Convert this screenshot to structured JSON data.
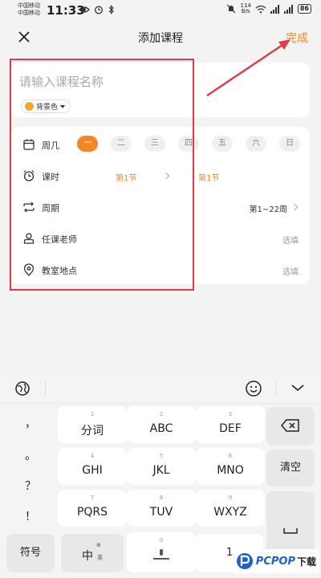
{
  "status_bar": {
    "carrier1": "中国移动",
    "carrier2": "中国移动",
    "time": "11:33",
    "speed_value": "114",
    "speed_unit": "B/s",
    "battery": "86"
  },
  "header": {
    "title": "添加课程",
    "done_label": "完成"
  },
  "course_card": {
    "name_placeholder": "请输入课程名称",
    "bg_color_label": "背景色",
    "bg_color": "#f4a833"
  },
  "form": {
    "weekday_label": "周几",
    "weekdays": [
      "一",
      "二",
      "三",
      "四",
      "五",
      "六",
      "日"
    ],
    "selected_weekday": "一",
    "period_label": "课时",
    "period_start": "第1节",
    "period_end": "第1节",
    "weeks_label": "周期",
    "weeks_value": "第1~22周",
    "teacher_label": "任课老师",
    "teacher_placeholder": "选填",
    "room_label": "教室地点",
    "room_placeholder": "选填"
  },
  "keyboard": {
    "punct": [
      "，",
      "。",
      "？",
      "！"
    ],
    "keys": [
      {
        "num": "1",
        "label": "分词"
      },
      {
        "num": "2",
        "label": "ABC"
      },
      {
        "num": "3",
        "label": "DEF"
      },
      {
        "num": "4",
        "label": "GHI"
      },
      {
        "num": "5",
        "label": "JKL"
      },
      {
        "num": "6",
        "label": "MNO"
      },
      {
        "num": "7",
        "label": "PQRS"
      },
      {
        "num": "8",
        "label": "TUV"
      },
      {
        "num": "9",
        "label": "WXYZ"
      }
    ],
    "clear_label": "清空",
    "symbols_label": "符号",
    "lang_label": "中",
    "lang_sub": "英",
    "space_num": "0",
    "last_key": "1"
  },
  "watermark": {
    "brand": "PCPOP",
    "suffix": "下载"
  },
  "colors": {
    "accent": "#f08a2c",
    "highlight_box": "#e53945"
  }
}
